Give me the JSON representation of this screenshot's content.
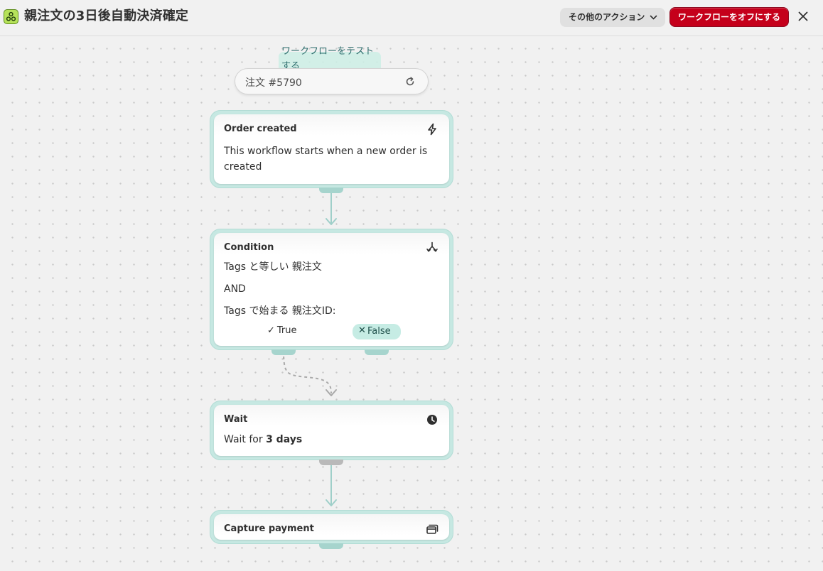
{
  "header": {
    "title": "親注文の3日後自動決済確定",
    "more_actions_label": "その他のアクション",
    "turn_off_label": "ワークフローをオフにする"
  },
  "canvas": {
    "test_tooltip": "ワークフローをテストする",
    "order_picker_label": "注文 #5790"
  },
  "nodes": {
    "order_created": {
      "title": "Order created",
      "description": "This workflow starts when a new order is created",
      "icon": "lightning-icon"
    },
    "condition": {
      "title": "Condition",
      "line1": "Tags と等しい 親注文",
      "line2": "AND",
      "line3": "Tags で始まる 親注文ID:",
      "true_label": "True",
      "false_label": "False",
      "icon": "branch-icon"
    },
    "wait": {
      "title": "Wait",
      "prefix": "Wait for",
      "duration": "3 days",
      "icon": "clock-icon"
    },
    "capture_payment": {
      "title": "Capture payment",
      "icon": "payment-card-icon"
    }
  },
  "colors": {
    "accent_red": "#c5001b",
    "node_border_teal": "#c6e8e2",
    "connector_teal": "#9fcfc9",
    "false_badge_bg": "#c6ece4"
  }
}
